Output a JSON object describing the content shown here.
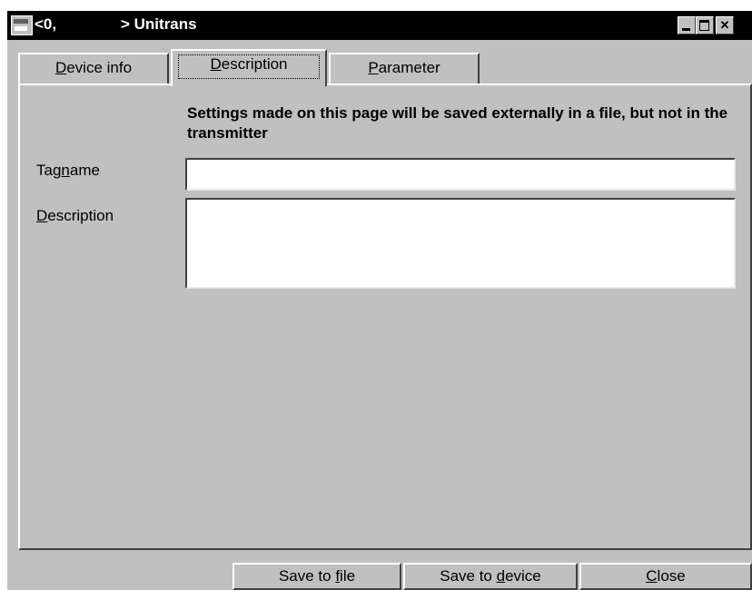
{
  "window": {
    "title_left": "<0,",
    "title_right": "> Unitrans"
  },
  "tabs": [
    {
      "pre": "",
      "key": "D",
      "post": "evice info",
      "selected": false
    },
    {
      "pre": "",
      "key": "D",
      "post": "escription",
      "selected": true
    },
    {
      "pre": "",
      "key": "P",
      "post": "arameter",
      "selected": false
    }
  ],
  "panel": {
    "info_text": "Settings made on this page will be saved externally in a file, but not in the transmitter",
    "tagname": {
      "pre": "Tag",
      "key": "n",
      "post": "ame",
      "value": ""
    },
    "description": {
      "pre": "",
      "key": "D",
      "post": "escription",
      "value": ""
    }
  },
  "buttons": {
    "save_file": {
      "pre": "Save to ",
      "key": "f",
      "post": "ile"
    },
    "save_device": {
      "pre": "Save to ",
      "key": "d",
      "post": "evice"
    },
    "close": {
      "pre": "",
      "key": "C",
      "post": "lose"
    }
  },
  "icons": {
    "app": "app-window-icon",
    "minimize": "minimize-icon",
    "maximize": "maximize-icon",
    "close": "close-icon"
  }
}
